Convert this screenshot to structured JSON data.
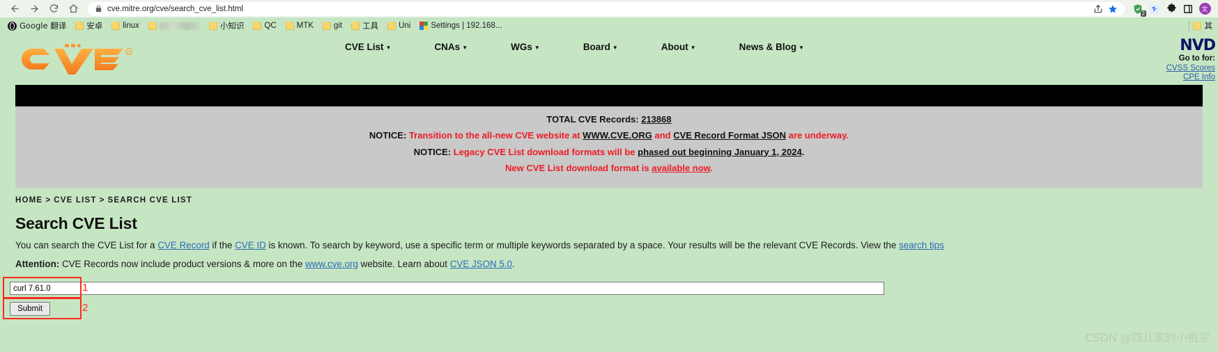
{
  "browser": {
    "back_icon": "back-arrow-icon",
    "forward_icon": "forward-arrow-icon",
    "reload_icon": "reload-icon",
    "home_icon": "home-icon",
    "lock_icon": "lock-icon",
    "url": "cve.mitre.org/cve/search_cve_list.html",
    "share_icon": "share-icon",
    "bookmark_star_icon": "star-icon",
    "ext_shield_badge": "2",
    "profile_initial": "文",
    "toolbar_icons": [
      "share-icon",
      "star-icon",
      "shield-extension-icon",
      "bird-extension-icon",
      "puzzle-extension-icon",
      "side-panel-icon",
      "profile-avatar"
    ]
  },
  "bookmarks": {
    "items": [
      {
        "label": "Google 翻译",
        "icon": "globe-icon"
      },
      {
        "label": "安卓",
        "icon": "folder-icon"
      },
      {
        "label": "linux",
        "icon": "folder-icon"
      },
      {
        "label": "",
        "icon": "folder-icon",
        "blurred": true
      },
      {
        "label": "小知识",
        "icon": "folder-icon"
      },
      {
        "label": "QC",
        "icon": "folder-icon"
      },
      {
        "label": "MTK",
        "icon": "folder-icon"
      },
      {
        "label": "git",
        "icon": "folder-icon"
      },
      {
        "label": "工具",
        "icon": "folder-icon"
      },
      {
        "label": "Uni",
        "icon": "folder-icon"
      },
      {
        "label": "Settings | 192.168...",
        "icon": "settings-icon"
      }
    ],
    "overflow": {
      "label": "其",
      "icon": "folder-icon"
    }
  },
  "site": {
    "logo_text": "CVE",
    "logo_registered": "®",
    "nav": [
      {
        "label": "CVE List"
      },
      {
        "label": "CNAs"
      },
      {
        "label": "WGs"
      },
      {
        "label": "Board"
      },
      {
        "label": "About"
      },
      {
        "label": "News & Blog"
      }
    ],
    "nvd": {
      "logo": "NVD",
      "goto_label": "Go to for:",
      "links": [
        "CVSS Scores",
        "CPE Info"
      ]
    }
  },
  "notices": {
    "total_label": "TOTAL CVE Records:",
    "total_value": "213868",
    "line1": {
      "prefix": "NOTICE:",
      "text_a": "Transition to the all-new CVE website at",
      "link_a": "WWW.CVE.ORG",
      "text_b": "and",
      "link_b": "CVE Record Format JSON",
      "text_c": "are underway."
    },
    "line2": {
      "prefix": "NOTICE:",
      "text_a": "Legacy CVE List download formats will be",
      "link_a": "phased out beginning January 1, 2024",
      "text_b": "."
    },
    "line3": {
      "text_a": "New CVE List download format is",
      "link_a": "available now",
      "text_b": "."
    }
  },
  "breadcrumb": {
    "items": [
      "HOME",
      "CVE LIST",
      "SEARCH CVE LIST"
    ],
    "separator": ">"
  },
  "main": {
    "title": "Search CVE List",
    "description": {
      "t1": "You can search the CVE List for a ",
      "l1": "CVE Record",
      "t2": " if the ",
      "l2": "CVE ID",
      "t3": " is known. To search by keyword, use a specific term or multiple keywords separated by a space. Your results will be the relevant CVE Records. View the ",
      "l3": "search tips",
      "t4": ""
    },
    "attention": {
      "bold": "Attention:",
      "t1": " CVE Records now include product versions & more on the ",
      "l1": "www.cve.org",
      "t2": " website. Learn about ",
      "l2": "CVE JSON 5.0",
      "t3": "."
    },
    "search": {
      "input_value": "curl 7.61.0",
      "input_placeholder": "",
      "submit_label": "Submit",
      "annotation_1": "1",
      "annotation_2": "2",
      "annotation_color": "#fb2a1e"
    }
  },
  "watermark": "CSDN @四儿家的小祖宗"
}
